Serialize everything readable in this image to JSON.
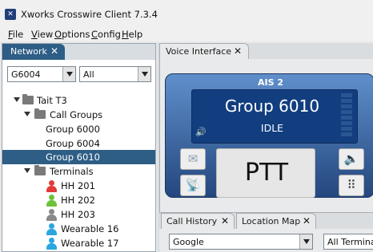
{
  "window": {
    "title": "Xworks Crosswire Client 7.3.4",
    "app_icon": "app-logo-icon"
  },
  "menu": {
    "file": "ile",
    "view": "iew",
    "options": "ptions",
    "config": "onfig",
    "help": "elp",
    "file_u": "F",
    "view_u": "V",
    "options_u": "O",
    "config_u": "C",
    "help_u": "H"
  },
  "network_panel": {
    "tab_label": "Network",
    "close_glyph": "✕",
    "group_select": "G6004",
    "filter_select": "All",
    "tree": {
      "root": "Tait T3",
      "call_groups_label": "Call Groups",
      "groups": [
        "Group 6000",
        "Group 6004",
        "Group 6010"
      ],
      "terminals_label": "Terminals",
      "terminals": [
        {
          "name": "HH 201",
          "color": "#e23b3b"
        },
        {
          "name": "HH 202",
          "color": "#6cc23a"
        },
        {
          "name": "HH 203",
          "color": "#8a8a8a"
        },
        {
          "name": "Wearable 16",
          "color": "#2aa6e0"
        },
        {
          "name": "Wearable 17",
          "color": "#2aa6e0"
        }
      ]
    }
  },
  "voice_interface": {
    "tab_label": "Voice Interface",
    "close_glyph": "✕",
    "console_name": "AIS 2",
    "group_display": "Group 6010",
    "status": "IDLE",
    "ptt_label": "PTT",
    "speaker_glyph": "🔊"
  },
  "bottom_tabs": {
    "call_history": "Call History",
    "location_map": "Location Map",
    "close_glyph": "✕",
    "map_source": "Google",
    "terminal_filter": "All Terminal"
  },
  "colors": {
    "accent": "#2e5e86",
    "console_top": "#5f8fcb",
    "console_bottom": "#24477e",
    "display": "#123e80"
  }
}
